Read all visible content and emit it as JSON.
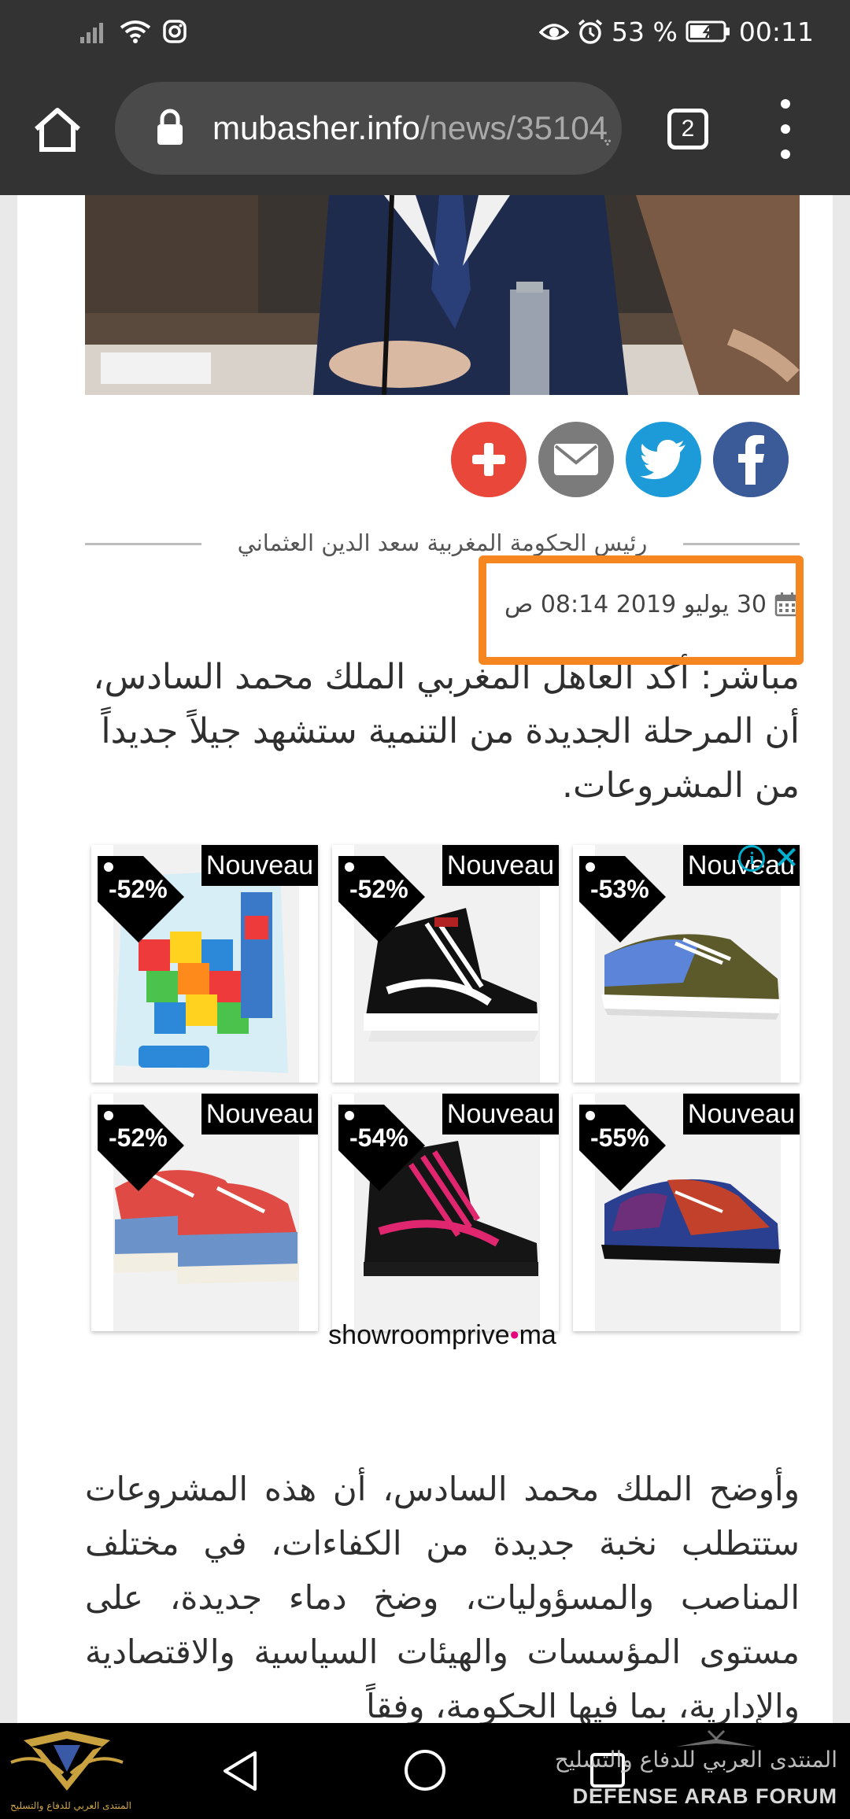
{
  "status_bar": {
    "battery": "53 %",
    "time": "00:11",
    "icons": [
      "signal-icon",
      "wifi-icon",
      "instagram-icon",
      "eye-comfort-icon",
      "alarm-icon",
      "battery-icon"
    ]
  },
  "browser": {
    "url_domain": "mubasher.info",
    "url_path": "/news/35104ֶ",
    "tab_count": "2"
  },
  "article": {
    "photo_caption": "رئيس الحكومة المغربية سعد الدين العثماني",
    "date": "30 يوليو 2019 08:14 ص",
    "lead": "مباشر: أكد العاهل المغربي الملك محمد السادس، أن المرحلة الجديدة من التنمية ستشهد جيلاً جديداً من المشروعات.",
    "body": "وأوضح الملك محمد السادس، أن هذه المشروعات ستتطلب نخبة جديدة من الكفاءات، في مختلف المناصب والمسؤوليات، وضخ دماء جديدة، على مستوى المؤسسات والهيئات السياسية والاقتصادية والإدارية، بما فيها الحكومة، وفقاً"
  },
  "share": {
    "buttons": [
      "plus-icon",
      "mail-icon",
      "twitter-icon",
      "facebook-icon"
    ]
  },
  "ad": {
    "brand": "showroomprive",
    "brand_dot": "•",
    "brand_tld": "ma",
    "info_symbol": "i",
    "close_symbol": "✕",
    "products": [
      {
        "label": "Nouveau",
        "discount": "-52%",
        "kind": "blocks-toy"
      },
      {
        "label": "Nouveau",
        "discount": "-52%",
        "kind": "hightop-black-white"
      },
      {
        "label": "Nouveau",
        "discount": "-53%",
        "kind": "lowtop-blue-olive"
      },
      {
        "label": "Nouveau",
        "discount": "-52%",
        "kind": "lowtop-red-blue"
      },
      {
        "label": "Nouveau",
        "discount": "-54%",
        "kind": "hightop-black-pink"
      },
      {
        "label": "Nouveau",
        "discount": "-55%",
        "kind": "lowtop-tiedye"
      }
    ]
  },
  "watermark": {
    "left_text": "المنتدى العربي للدفاع والتسليح",
    "right_arabic": "المنتدى العربي للدفاع والتسليح",
    "right_english": "DEFENSE ARAB FORUM"
  },
  "colors": {
    "highlight": "#f6861f",
    "share_plus": "#e8473a",
    "share_mail": "#7b7b7b",
    "twitter": "#1d9bd8",
    "facebook": "#3b5a98",
    "brand_dot": "#e6007e"
  }
}
